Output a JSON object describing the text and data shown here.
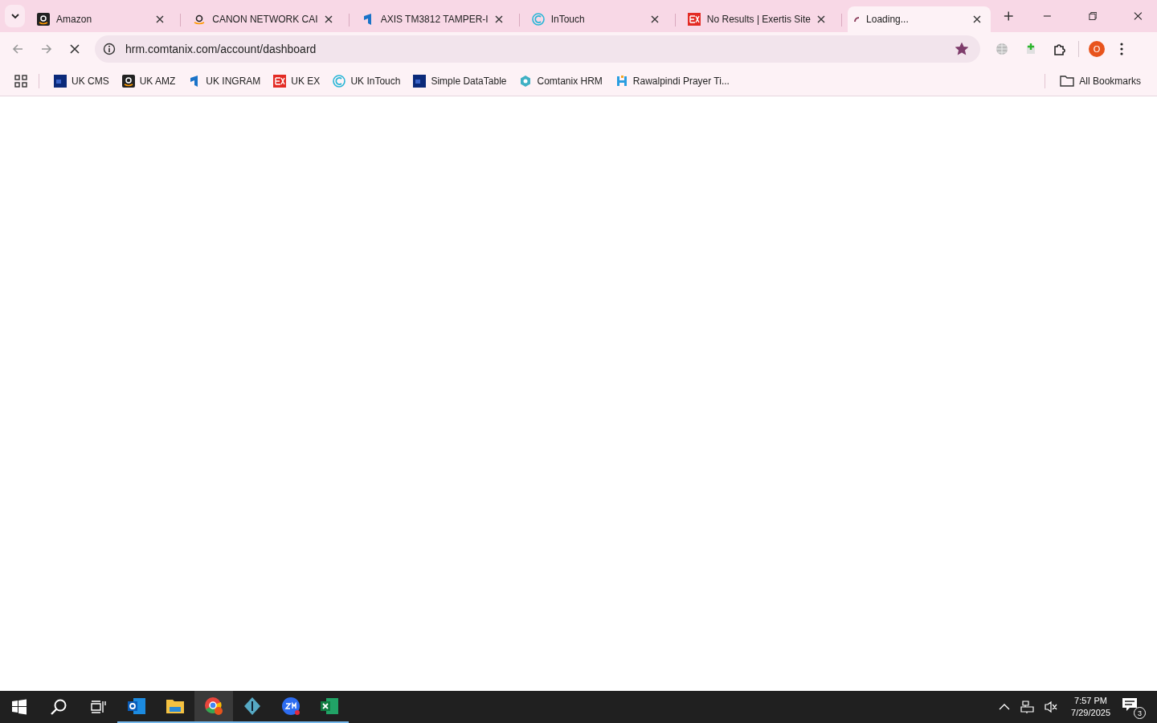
{
  "tabs": [
    {
      "title": "Amazon",
      "selected": false
    },
    {
      "title": "CANON NETWORK CAI",
      "selected": false
    },
    {
      "title": "AXIS TM3812 TAMPER-I",
      "selected": false
    },
    {
      "title": "InTouch",
      "selected": false
    },
    {
      "title": "No Results | Exertis Site",
      "selected": false
    },
    {
      "title": "Loading...",
      "selected": true
    }
  ],
  "address_bar": {
    "url": "hrm.comtanix.com/account/dashboard",
    "bookmarked": true
  },
  "profile": {
    "initial": "O"
  },
  "bookmarks": [
    {
      "label": "UK CMS"
    },
    {
      "label": "UK AMZ"
    },
    {
      "label": "UK INGRAM"
    },
    {
      "label": "UK EX"
    },
    {
      "label": "UK InTouch"
    },
    {
      "label": "Simple DataTable"
    },
    {
      "label": "Comtanix HRM"
    },
    {
      "label": "Rawalpindi Prayer Ti..."
    }
  ],
  "all_bookmarks": "All Bookmarks",
  "taskbar": {
    "apps": [
      {
        "selected": false
      },
      {
        "selected": false
      },
      {
        "selected": true
      },
      {
        "selected": false
      },
      {
        "selected": false
      },
      {
        "selected": false
      }
    ],
    "time": "7:57 PM",
    "date": "7/29/2025",
    "notifications": "3"
  }
}
